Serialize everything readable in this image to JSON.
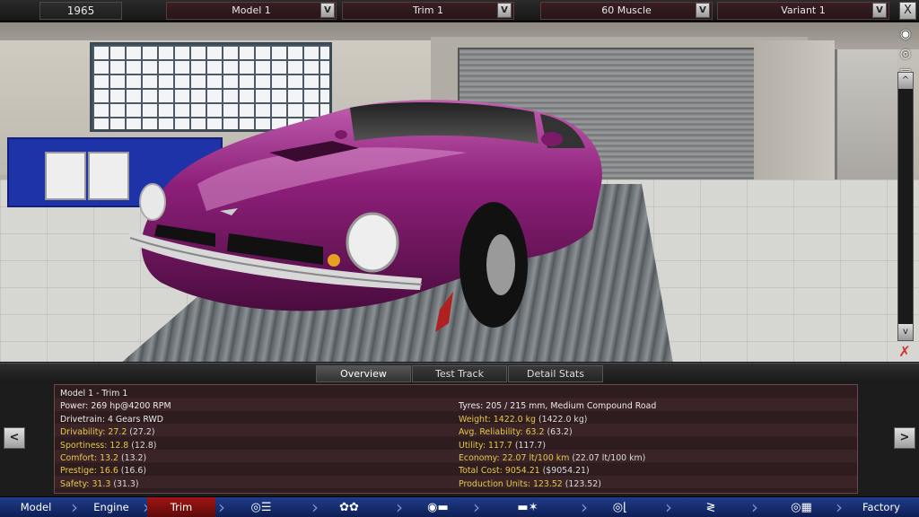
{
  "topbar": {
    "year": "1965",
    "model": "Model 1",
    "trim": "Trim 1",
    "body": "60 Muscle",
    "variant": "Variant 1",
    "dropdown_glyph": "V",
    "close_glyph": "X"
  },
  "view_tools": {
    "icons": [
      "camera-icon",
      "eye-icon",
      "car-front-icon",
      "car-side-icon",
      "car-rear-icon",
      "car-top-icon"
    ]
  },
  "scroll": {
    "up_glyph": "^",
    "down_glyph": "v"
  },
  "tabs": {
    "overview": "Overview",
    "test_track": "Test Track",
    "detail_stats": "Detail Stats"
  },
  "nav_arrows": {
    "left": "<",
    "right": ">"
  },
  "stats": {
    "left": [
      {
        "label": "Model 1 - Trim 1",
        "value": "",
        "style": "white"
      },
      {
        "label": "Power: 269 hp@4200 RPM",
        "value": "",
        "style": "white"
      },
      {
        "label": "Drivetrain: 4 Gears RWD",
        "value": "",
        "style": "white"
      },
      {
        "label": "Drivability: 27.2",
        "value": "(27.2)",
        "style": "yellow"
      },
      {
        "label": "Sportiness: 12.8",
        "value": "(12.8)",
        "style": "yellow"
      },
      {
        "label": "Comfort: 13.2",
        "value": "(13.2)",
        "style": "yellow"
      },
      {
        "label": "Prestige: 16.6",
        "value": "(16.6)",
        "style": "yellow"
      },
      {
        "label": "Safety: 31.3",
        "value": "(31.3)",
        "style": "yellow"
      }
    ],
    "right": [
      {
        "label": "",
        "value": "",
        "style": "white"
      },
      {
        "label": "Tyres: 205 / 215 mm, Medium Compound Road",
        "value": "",
        "style": "white"
      },
      {
        "label": "Weight: 1422.0 kg",
        "value": "(1422.0 kg)",
        "style": "yellow"
      },
      {
        "label": "Avg. Reliability: 63.2",
        "value": "(63.2)",
        "style": "yellow"
      },
      {
        "label": "Utility: 117.7",
        "value": "(117.7)",
        "style": "yellow"
      },
      {
        "label": "Economy: 22.07 lt/100 km",
        "value": "(22.07 lt/100 km)",
        "style": "yellow"
      },
      {
        "label": "Total Cost: 9054.21",
        "value": "($9054.21)",
        "style": "yellow"
      },
      {
        "label": "Production Units: 123.52",
        "value": "(123.52)",
        "style": "yellow"
      }
    ]
  },
  "bottom_nav": {
    "model": "Model",
    "engine": "Engine",
    "trim": "Trim",
    "factory": "Factory",
    "icons": [
      "chassis-icon",
      "gearbox-icon",
      "wheels-icon",
      "body-icon",
      "car-icon",
      "fan-icon",
      "steering-icon",
      "seat-icon",
      "suspension-icon",
      "test-drive-icon"
    ]
  },
  "colors": {
    "car_body": "#8e1f7a",
    "active_nav": "#a01414",
    "nav_bg": "#1f3c8a",
    "stat_highlight": "#e6c84a"
  }
}
